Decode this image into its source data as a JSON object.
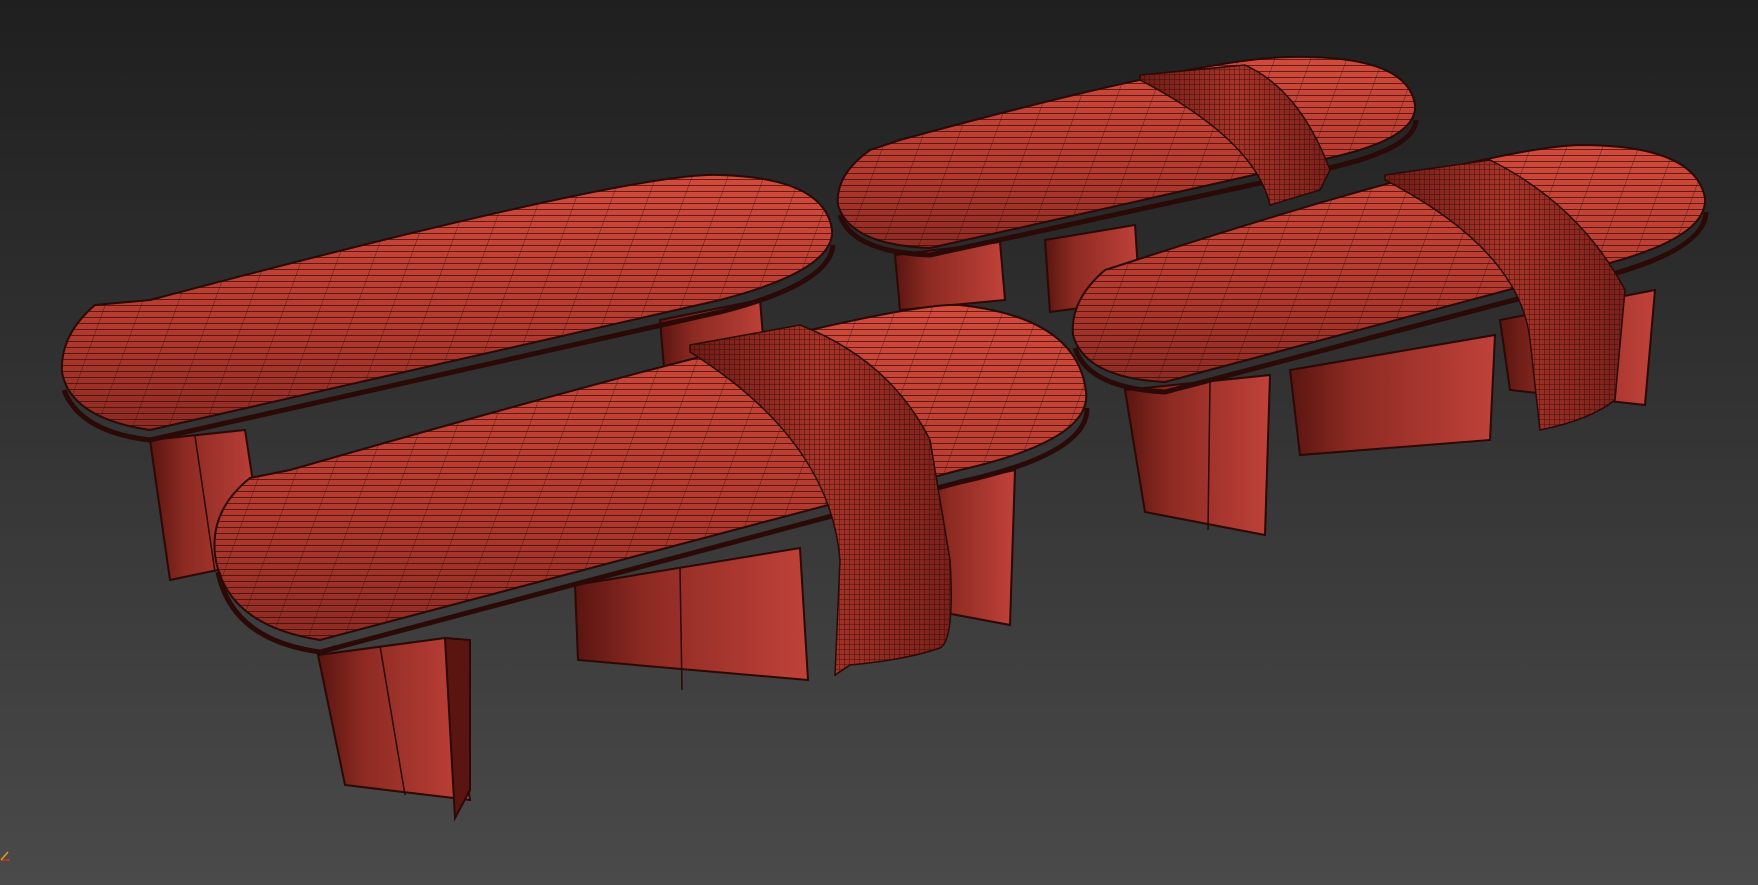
{
  "viewport": {
    "background_top": "#1f1f1f",
    "background_bottom": "#4a4a4a",
    "shading": "edged-faces",
    "object_color": "#b4392e",
    "object_shadow_color": "#5a1510",
    "wire_color": "#2a0906",
    "objects": [
      {
        "id": "bench-back-left",
        "throw": false
      },
      {
        "id": "bench-back-right",
        "throw": true
      },
      {
        "id": "bench-front-right",
        "throw": true
      },
      {
        "id": "bench-front-left",
        "throw": true
      }
    ],
    "axis_gizmo": {
      "x_color": "#d03020",
      "y_color": "#d8a020"
    }
  }
}
